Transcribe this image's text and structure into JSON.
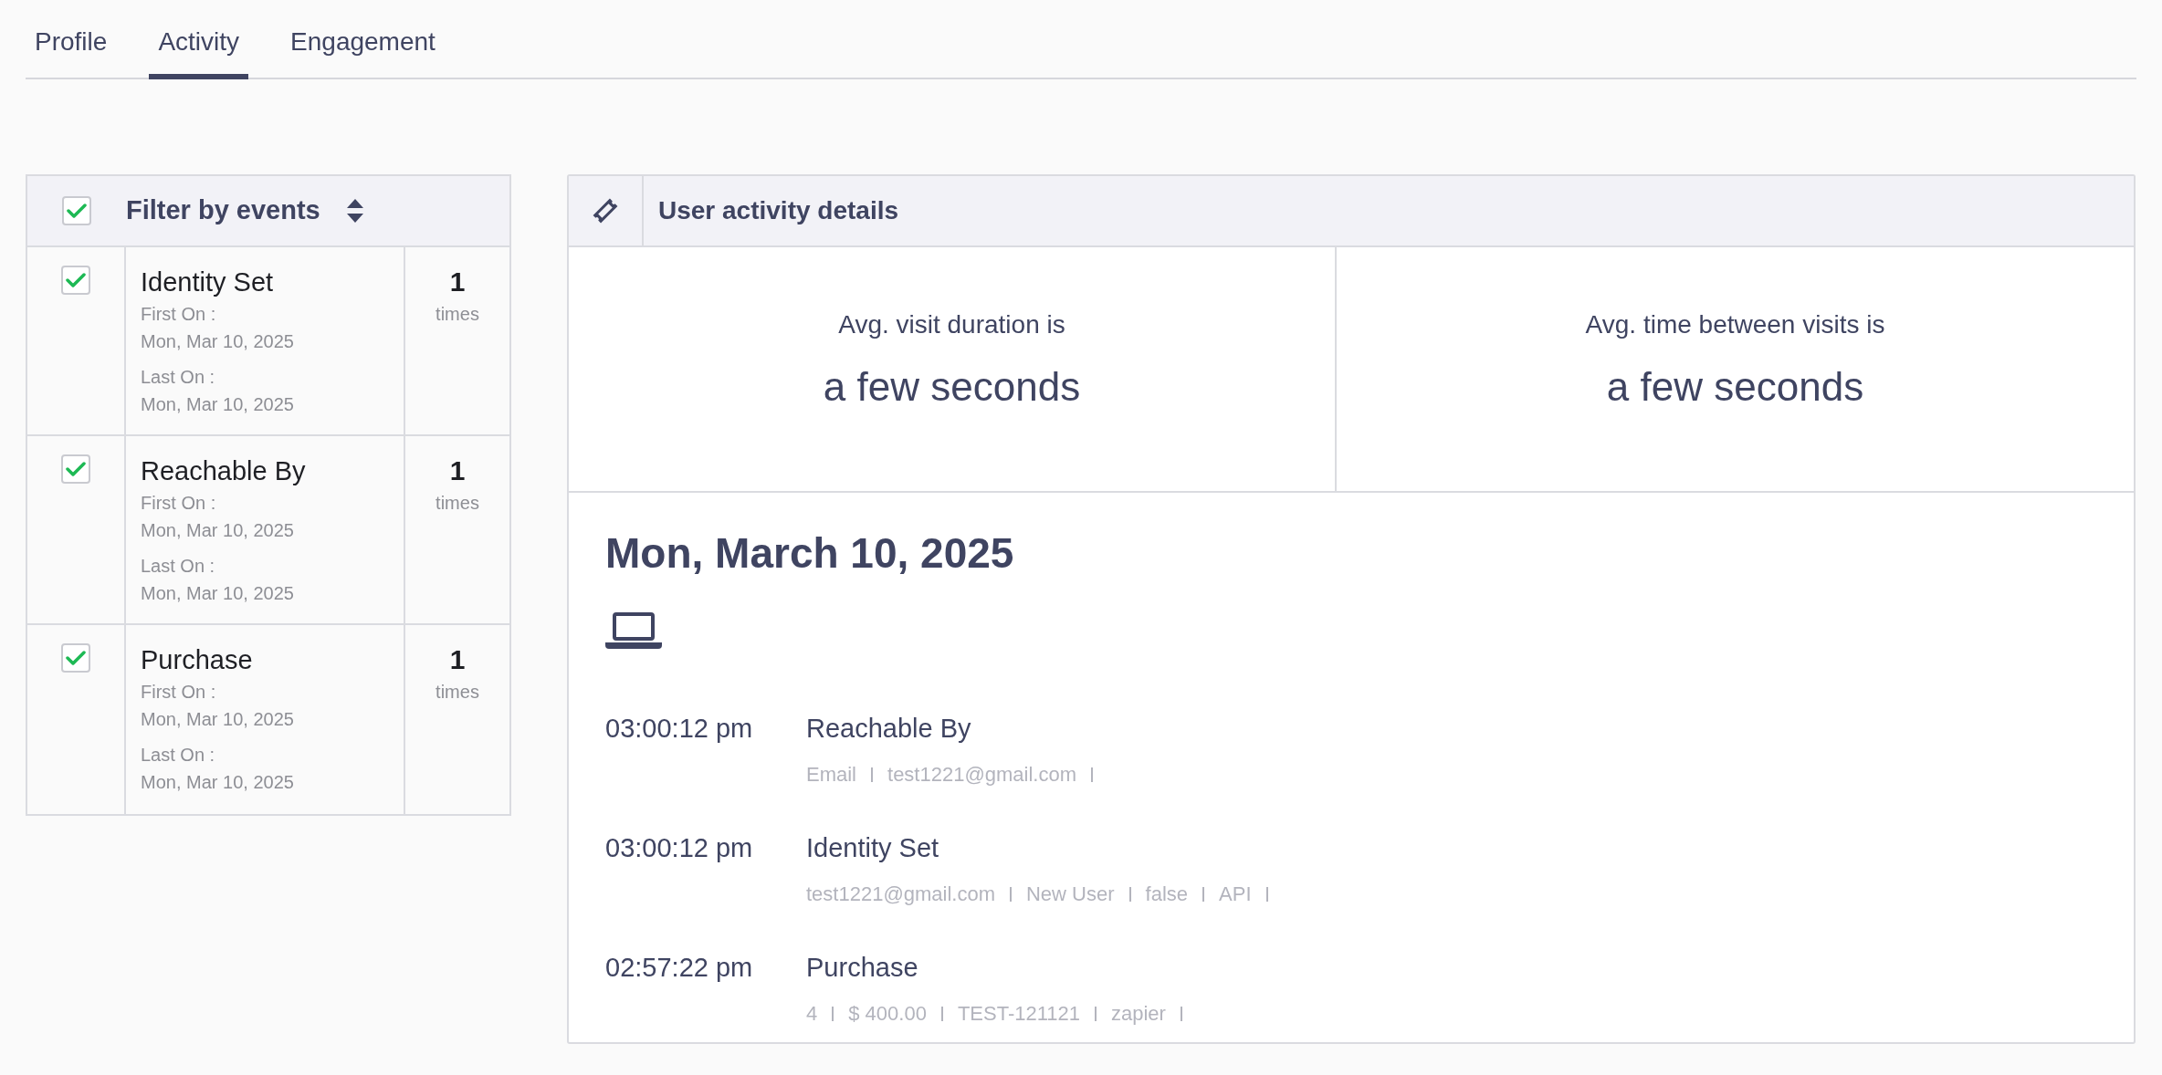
{
  "tabs": [
    {
      "label": "Profile",
      "selected": false
    },
    {
      "label": "Activity",
      "selected": true
    },
    {
      "label": "Engagement",
      "selected": false
    }
  ],
  "filter_panel": {
    "title": "Filter by events",
    "all_checked": true,
    "events": [
      {
        "name": "Identity Set",
        "checked": true,
        "first_label": "First On :",
        "first_date": "Mon, Mar 10, 2025",
        "last_label": "Last On :",
        "last_date": "Mon, Mar 10, 2025",
        "count": "1",
        "count_unit": "times"
      },
      {
        "name": "Reachable By",
        "checked": true,
        "first_label": "First On :",
        "first_date": "Mon, Mar 10, 2025",
        "last_label": "Last On :",
        "last_date": "Mon, Mar 10, 2025",
        "count": "1",
        "count_unit": "times"
      },
      {
        "name": "Purchase",
        "checked": true,
        "first_label": "First On :",
        "first_date": "Mon, Mar 10, 2025",
        "last_label": "Last On :",
        "last_date": "Mon, Mar 10, 2025",
        "count": "1",
        "count_unit": "times"
      }
    ]
  },
  "details_panel": {
    "title": "User activity details",
    "stats": [
      {
        "label": "Avg. visit duration is",
        "value": "a few seconds"
      },
      {
        "label": "Avg. time between visits is",
        "value": "a few seconds"
      }
    ],
    "date": "Mon, March 10, 2025",
    "entries": [
      {
        "time": "03:00:12 pm",
        "event": "Reachable By",
        "details": [
          "Email",
          "test1221@gmail.com"
        ]
      },
      {
        "time": "03:00:12 pm",
        "event": "Identity Set",
        "details": [
          "test1221@gmail.com",
          "New User",
          "false",
          "API"
        ]
      },
      {
        "time": "02:57:22 pm",
        "event": "Purchase",
        "details": [
          "4",
          "$ 400.00",
          "TEST-121121",
          "zapier"
        ]
      }
    ]
  }
}
